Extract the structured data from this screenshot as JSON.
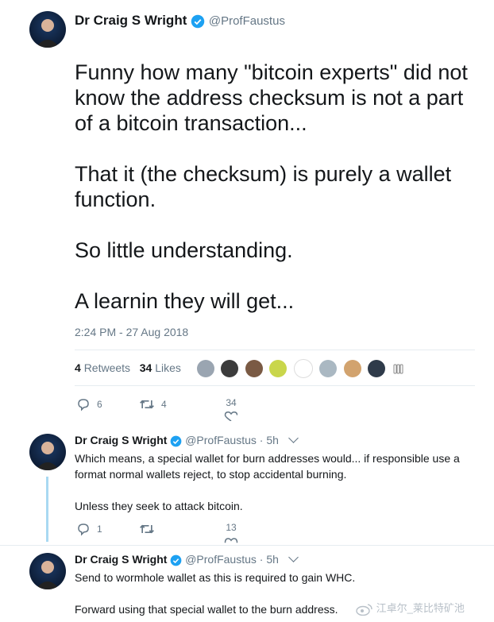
{
  "main_tweet": {
    "display_name": "Dr Craig S Wright",
    "handle": "@ProfFaustus",
    "paragraphs": [
      "Funny how many \"bitcoin experts\" did not know the address checksum is not a part of a bitcoin transaction...",
      "That it (the checksum) is purely a wallet function.",
      "So little understanding.",
      "A learnin they will get..."
    ],
    "timestamp": "2:24 PM - 27 Aug 2018",
    "stats": {
      "retweets_count": "4",
      "retweets_label": "Retweets",
      "likes_count": "34",
      "likes_label": "Likes"
    },
    "actions": {
      "replies": "6",
      "retweets": "4",
      "likes": "34"
    }
  },
  "replies": [
    {
      "display_name": "Dr Craig S Wright",
      "handle": "@ProfFaustus",
      "time": "· 5h",
      "paragraphs": [
        "Which means, a special wallet for burn addresses would... if responsible use a format normal wallets reject, to stop accidental burning.",
        "Unless they seek to attack bitcoin."
      ],
      "actions": {
        "replies": "1",
        "retweets": "",
        "likes": "13"
      }
    },
    {
      "display_name": "Dr Craig S Wright",
      "handle": "@ProfFaustus",
      "time": "· 5h",
      "paragraphs": [
        "Send to wormhole wallet as this is required to gain WHC.",
        "Forward using that special wallet to the burn address."
      ]
    }
  ],
  "watermark": "江卓尔_莱比特矿池",
  "colors": {
    "verified": "#1da1f2",
    "thread_line": "#a9d9f2",
    "muted": "#657786",
    "text": "#14171a"
  }
}
